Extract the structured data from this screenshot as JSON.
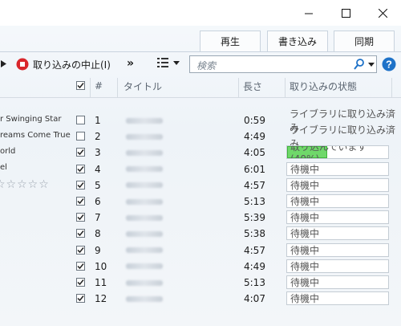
{
  "window": {
    "minimize_icon": "minimize-icon",
    "maximize_icon": "maximize-icon",
    "close_icon": "close-icon"
  },
  "tabs": [
    {
      "label": "再生"
    },
    {
      "label": "書き込み"
    },
    {
      "label": "同期"
    }
  ],
  "toolbar": {
    "stop_rip_label": "取り込みの中止(I)",
    "more_label": "»",
    "search_placeholder": "検索"
  },
  "left_list": [
    {
      "text": "r Swinging Star"
    },
    {
      "text": "reams Come True"
    },
    {
      "text": "orld"
    },
    {
      "text": "el"
    }
  ],
  "columns": {
    "num": "#",
    "title": "タイトル",
    "length": "長さ",
    "status": "取り込みの状態"
  },
  "tracks": [
    {
      "num": "1",
      "length": "0:59",
      "checked": false,
      "status": "ライブラリに取り込み済み"
    },
    {
      "num": "2",
      "length": "4:49",
      "checked": false,
      "status": "ライブラリに取り込み済み"
    },
    {
      "num": "3",
      "length": "4:05",
      "checked": true,
      "status": "取り込んでいます (40%)",
      "progress": 0.4
    },
    {
      "num": "4",
      "length": "6:01",
      "checked": true,
      "status": "待機中"
    },
    {
      "num": "5",
      "length": "4:57",
      "checked": true,
      "status": "待機中"
    },
    {
      "num": "6",
      "length": "5:13",
      "checked": true,
      "status": "待機中"
    },
    {
      "num": "7",
      "length": "5:39",
      "checked": true,
      "status": "待機中"
    },
    {
      "num": "8",
      "length": "5:38",
      "checked": true,
      "status": "待機中"
    },
    {
      "num": "9",
      "length": "4:57",
      "checked": true,
      "status": "待機中"
    },
    {
      "num": "10",
      "length": "4:49",
      "checked": true,
      "status": "待機中"
    },
    {
      "num": "11",
      "length": "5:13",
      "checked": true,
      "status": "待機中"
    },
    {
      "num": "12",
      "length": "4:07",
      "checked": true,
      "status": "待機中"
    }
  ],
  "colors": {
    "accent": "#1e72c8",
    "stop": "#d9262b",
    "progress": "#6fd86a"
  }
}
